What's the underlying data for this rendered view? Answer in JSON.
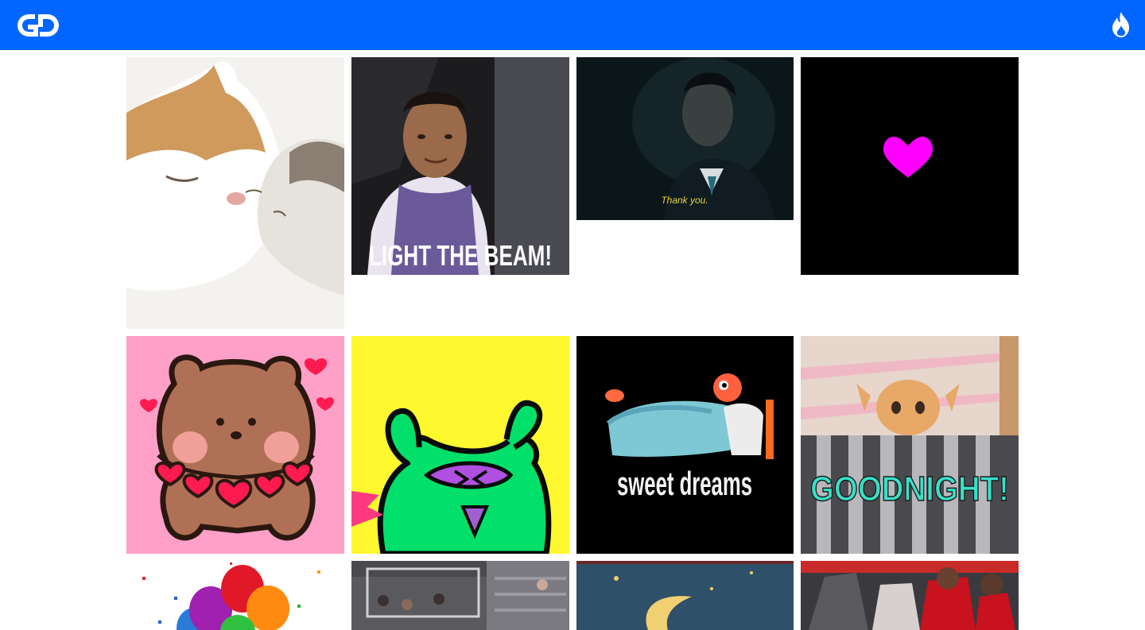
{
  "header": {
    "logo_icon": "gifs-logo-icon",
    "trending_icon": "fire-icon",
    "background_color": "#0066ff"
  },
  "gifs": [
    {
      "name": "cats-nuzzling",
      "overlay_text": "",
      "bg": "#f5f3f0"
    },
    {
      "name": "player-smile",
      "overlay_text": "LIGHT THE BEAM!",
      "bg": "#1a1a1a"
    },
    {
      "name": "man-in-suit-dark",
      "overlay_text": "Thank you.",
      "bg": "#0d1a1c"
    },
    {
      "name": "pink-heart",
      "overlay_text": "",
      "bg": "#000000"
    },
    {
      "name": "bear-with-hearts",
      "overlay_text": "",
      "bg": "#ffa0c8"
    },
    {
      "name": "green-dinosaur",
      "overlay_text": "",
      "bg": "#fff82e"
    },
    {
      "name": "clay-sleeping",
      "overlay_text": "sweet dreams",
      "bg": "#000000"
    },
    {
      "name": "kitten-goodnight",
      "overlay_text": "GOODNIGHT!",
      "bg": "#d9c8c0"
    },
    {
      "name": "balloons",
      "overlay_text": "",
      "bg": "#ffffff"
    },
    {
      "name": "basketball-crowd",
      "overlay_text": "",
      "bg": "#6e6e70"
    },
    {
      "name": "moon-night",
      "overlay_text": "",
      "bg": "#2c4e6a"
    },
    {
      "name": "raptors-players",
      "overlay_text": "",
      "bg": "#2a2a2a"
    }
  ]
}
